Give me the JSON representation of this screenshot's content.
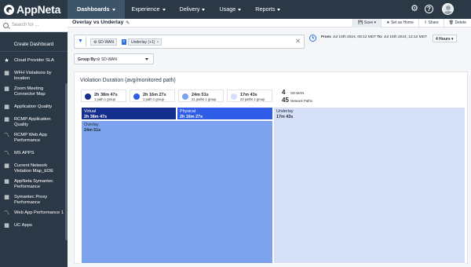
{
  "app": {
    "brand": "AppNeta"
  },
  "nav": {
    "items": [
      {
        "label": "Dashboards",
        "active": true
      },
      {
        "label": "Experience"
      },
      {
        "label": "Delivery"
      },
      {
        "label": "Usage"
      },
      {
        "label": "Reports"
      }
    ]
  },
  "topicons": {
    "gear": "gear-icon",
    "help": "help-icon",
    "avatar": "avatar"
  },
  "sidebar": {
    "search_placeholder": "Search for ...",
    "create_label": "Create Dashboard",
    "items": [
      {
        "label": "Cloud Provider SLA",
        "icon": "star-icon"
      },
      {
        "label": "WFH Violations by location",
        "icon": "grid-icon"
      },
      {
        "label": "Zoom Meeting Connector Map",
        "icon": "grid-icon"
      },
      {
        "label": "Application Quality",
        "icon": "grid-icon"
      },
      {
        "label": "RCMP Application Quality",
        "icon": "grid-icon"
      },
      {
        "label": "RCMP Web App Performance",
        "icon": "chart-icon"
      },
      {
        "label": "MS APPS",
        "icon": "chart-icon"
      },
      {
        "label": "Current Network Violation Map_EDE",
        "icon": "grid-icon"
      },
      {
        "label": "AppNeta Symantec Performance",
        "icon": "grid-icon"
      },
      {
        "label": "Symantec Proxy Performance",
        "icon": "grid-icon"
      },
      {
        "label": "Web App Performance 1",
        "icon": "chart-icon"
      },
      {
        "label": "UC Apps",
        "icon": "grid-icon"
      }
    ]
  },
  "page": {
    "title": "Overlay vs Underlay",
    "actions": {
      "save": "Save",
      "set_home": "Set as Home",
      "share": "Share",
      "delete": "Delete"
    }
  },
  "filters": {
    "chip1": "SD-WAN",
    "chip2": "Underlay (+1)"
  },
  "time": {
    "from_label": "From:",
    "from_value": "Jul 16th 2024, 08:12 MDT",
    "to_label": "To:",
    "to_value": "Jul 16th 2024, 12:12 MDT",
    "range": "4 Hours"
  },
  "groupby": {
    "label": "Group By:",
    "value": "SD-WAN"
  },
  "widget": {
    "title": "Violation Duration (avg/monitored path)",
    "legend": [
      {
        "value": "2h 38m 47s",
        "sub": "1 path    1 group",
        "color": "#152f8f"
      },
      {
        "value": "2h 16m 27s",
        "sub": "1 path    1 group",
        "color": "#2f5de8"
      },
      {
        "value": "24m 51s",
        "sub": "21 paths    1 group",
        "color": "#7ea3ee"
      },
      {
        "value": "17m 43s",
        "sub": "22 paths    1 group",
        "color": "#d5e0f8"
      }
    ],
    "counts": [
      {
        "num": "4",
        "label": "SD-WAN"
      },
      {
        "num": "45",
        "label": "Network Paths"
      }
    ],
    "treemap": [
      {
        "name": "Virtual",
        "value": "2h 38m 47s",
        "color": "#152f8f",
        "text": "#ffffff"
      },
      {
        "name": "Physical",
        "value": "2h 16m 27s",
        "color": "#2f5de8",
        "text": "#ffffff"
      },
      {
        "name": "Underlay",
        "value": "17m 43s",
        "color": "#d5e0f8",
        "text": "#1f2733"
      },
      {
        "name": "Overlay",
        "value": "24m 51s",
        "color": "#7ea3ee",
        "text": "#1f2733"
      }
    ]
  }
}
